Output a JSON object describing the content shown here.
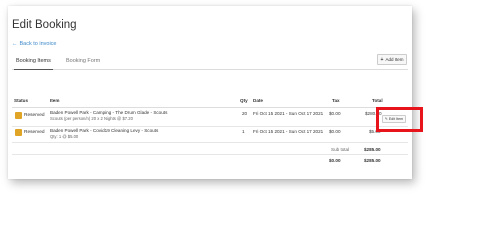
{
  "page": {
    "title": "Edit Booking",
    "back_link": "Back to invoice"
  },
  "tabs": [
    {
      "label": "Booking Items",
      "active": true
    },
    {
      "label": "Booking Form",
      "active": false
    }
  ],
  "toolbar": {
    "add_item_label": "Add Item"
  },
  "table": {
    "columns": {
      "status": "Status",
      "item": "Item",
      "qty": "Qty",
      "date": "Date",
      "tax": "Tax",
      "total": "Total"
    },
    "rows": [
      {
        "status": "Reserved",
        "item": "Baden Powell Park - Camping - The Drum Glade - Scouts",
        "item_detail": "Scouts (per person/n) 20 x 2 Nights @ $7.20",
        "qty": "20",
        "date": "Fri Oct 15 2021 - Sun Oct 17 2021",
        "tax": "$0.00",
        "total": "$280.00",
        "edit_label": "Edit Item"
      },
      {
        "status": "Reserved",
        "item": "Baden Powell Park - Covid19 Cleaning Levy - Scouts",
        "item_detail": "Qty: 1 @ $5.00",
        "qty": "1",
        "date": "Fri Oct 15 2021 - Sun Oct 17 2021",
        "tax": "$0.00",
        "total": "$5.00"
      }
    ],
    "subtotal_label": "Sub total",
    "subtotal_value": "$285.00",
    "grand_tax": "$0.00",
    "grand_total": "$285.00"
  },
  "colors": {
    "reserved_badge": "#e0a526",
    "link": "#3a87c8",
    "highlight": "#e8141b"
  }
}
